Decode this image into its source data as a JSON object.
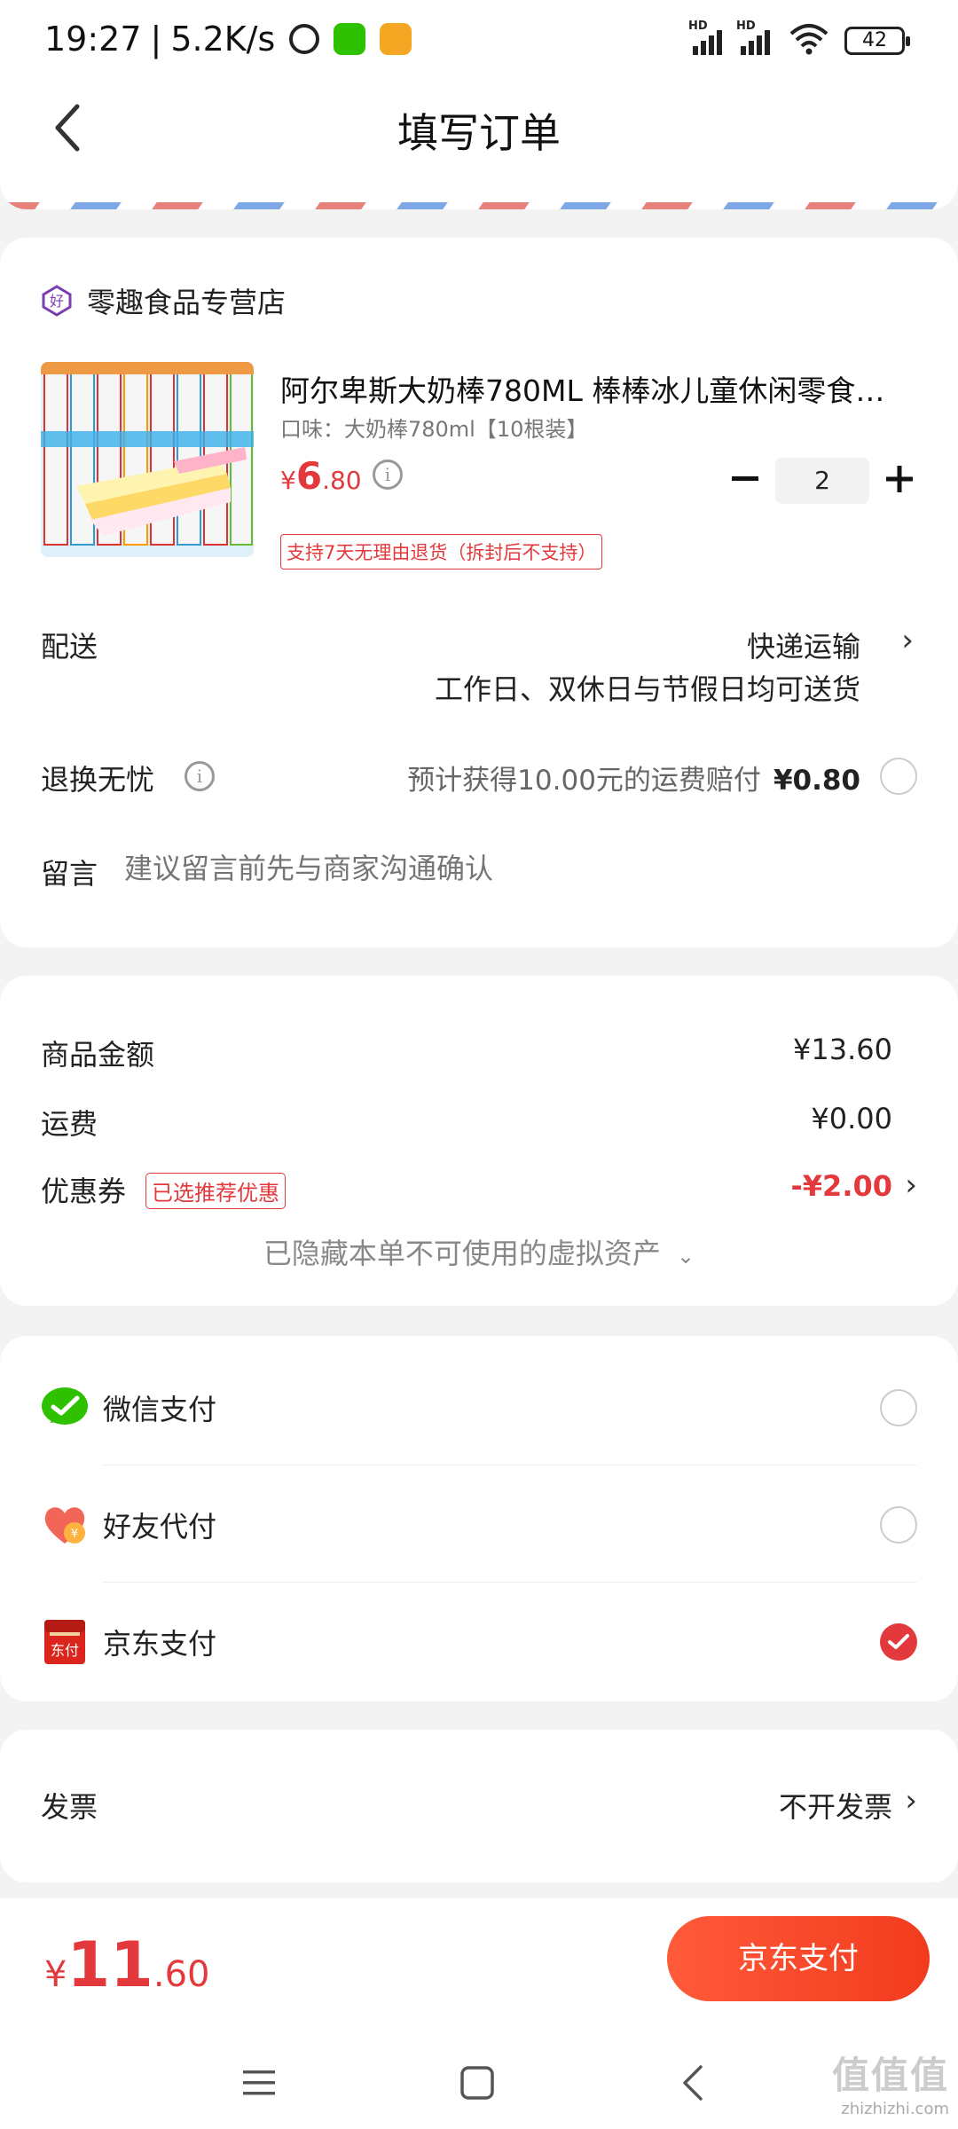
{
  "status_bar": {
    "time": "19:27",
    "speed": "5.2K/s",
    "battery": "42"
  },
  "header": {
    "title": "填写订单"
  },
  "store": {
    "name": "零趣食品专营店"
  },
  "product": {
    "title": "阿尔卑斯大奶棒780ML 棒棒冰儿童休闲零食…",
    "spec": "口味：大奶棒780ml【10根装】",
    "price_currency": "¥",
    "price_int": "6",
    "price_dec": ".80",
    "quantity": "2",
    "return_policy": "支持7天无理由退货（拆封后不支持）"
  },
  "delivery": {
    "label": "配送",
    "method": "快递运输",
    "note": "工作日、双休日与节假日均可送货"
  },
  "insurance": {
    "label": "退换无忧",
    "description": "预计获得10.00元的运费赔付",
    "price": "¥0.80"
  },
  "note": {
    "label": "留言",
    "placeholder": "建议留言前先与商家沟通确认"
  },
  "amounts": {
    "goods_label": "商品金额",
    "goods_value": "¥13.60",
    "shipping_label": "运费",
    "shipping_value": "¥0.00",
    "coupon_label": "优惠券",
    "coupon_tag": "已选推荐优惠",
    "coupon_value": "-¥2.00",
    "hidden_assets": "已隐藏本单不可使用的虚拟资产"
  },
  "payment": {
    "options": [
      {
        "label": "微信支付",
        "icon": "wechat-pay-icon",
        "selected": false
      },
      {
        "label": "好友代付",
        "icon": "friend-pay-icon",
        "selected": false
      },
      {
        "label": "京东支付",
        "icon": "jd-pay-icon",
        "selected": true
      }
    ]
  },
  "invoice": {
    "label": "发票",
    "value": "不开发票"
  },
  "footer": {
    "total_currency": "¥",
    "total_int": "11",
    "total_dec": ".60",
    "pay_button": "京东支付"
  },
  "watermark": {
    "logo": "值值值",
    "url": "zhizhizhi.com"
  },
  "colors": {
    "accent": "#e4393c",
    "pay_button": "#f23b1e",
    "wechat": "#2dc100"
  }
}
